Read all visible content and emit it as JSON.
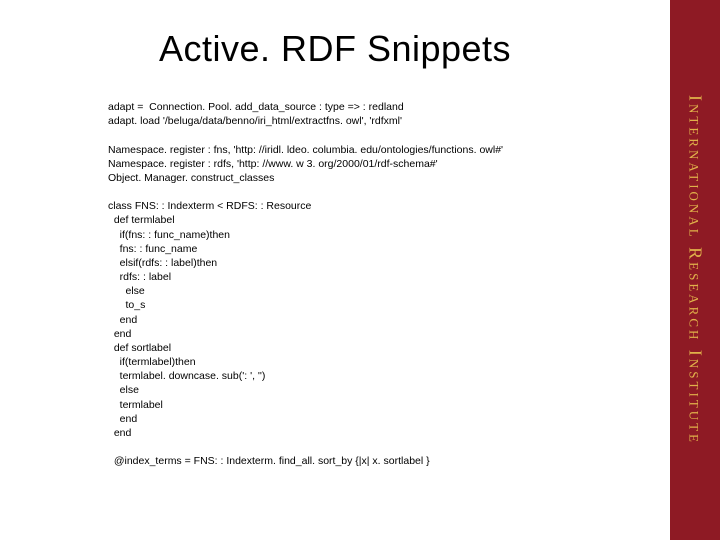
{
  "title": "Active. RDF Snippets",
  "sidebar_text": "International Research Institute",
  "code": "adapt =  Connection. Pool. add_data_source : type => : redland\nadapt. load '/beluga/data/benno/iri_html/extractfns. owl', 'rdfxml'\n\nNamespace. register : fns, 'http: //iridl. ldeo. columbia. edu/ontologies/functions. owl#'\nNamespace. register : rdfs, 'http: //www. w 3. org/2000/01/rdf-schema#'\nObject. Manager. construct_classes\n\nclass FNS: : Indexterm < RDFS: : Resource\n  def termlabel\n    if(fns: : func_name)then\n    fns: : func_name\n    elsif(rdfs: : label)then\n    rdfs: : label\n      else\n      to_s\n    end\n  end\n  def sortlabel\n    if(termlabel)then\n    termlabel. downcase. sub(': ', '')\n    else\n    termlabel\n    end\n  end\n\n  @index_terms = FNS: : Indexterm. find_all. sort_by {|x| x. sortlabel }"
}
